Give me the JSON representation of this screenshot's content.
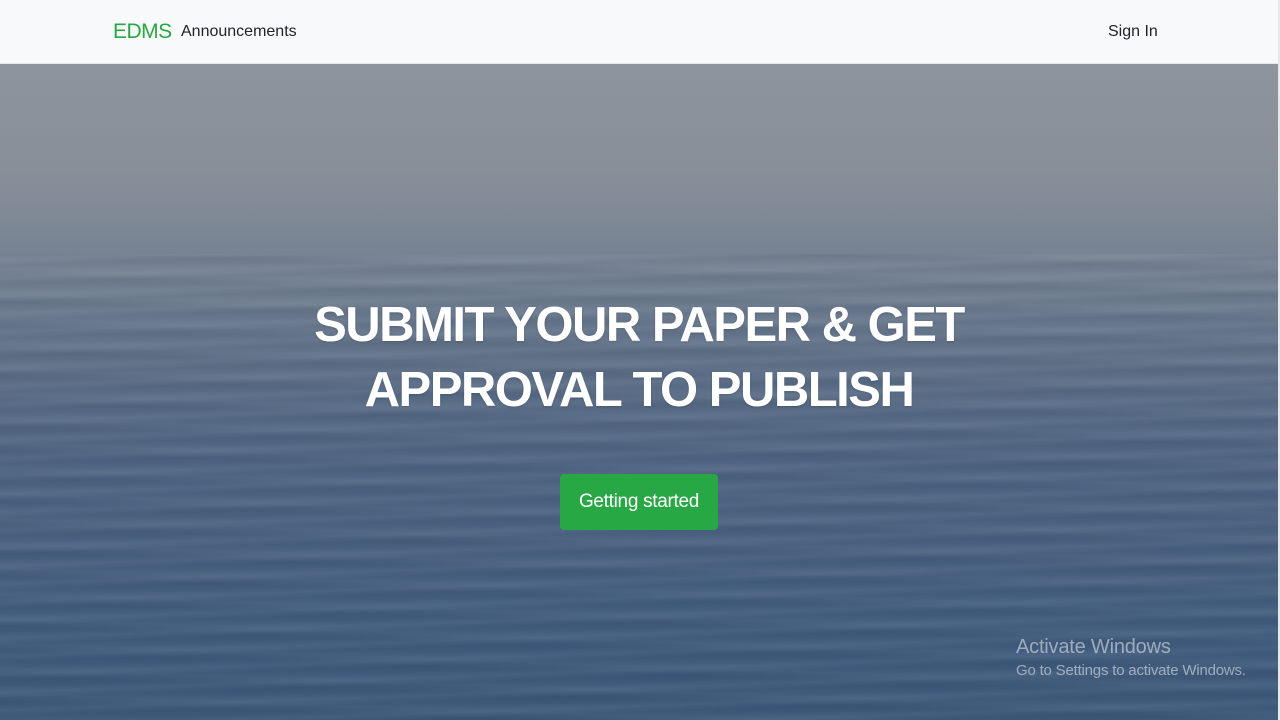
{
  "navbar": {
    "brand": "EDMS",
    "links": [
      {
        "label": "Announcements"
      }
    ],
    "sign_in_label": "Sign In"
  },
  "hero": {
    "headline_line1": "SUBMIT YOUR PAPER & GET",
    "headline_line2": "APPROVAL TO PUBLISH",
    "cta_label": "Getting started",
    "background": "ocean-photo"
  },
  "watermark": {
    "title": "Activate Windows",
    "subtitle": "Go to Settings to activate Windows."
  },
  "colors": {
    "accent": "#28a745",
    "navbar_bg": "#f8f9fa",
    "text_dark": "#212529",
    "headline": "#ffffff"
  }
}
